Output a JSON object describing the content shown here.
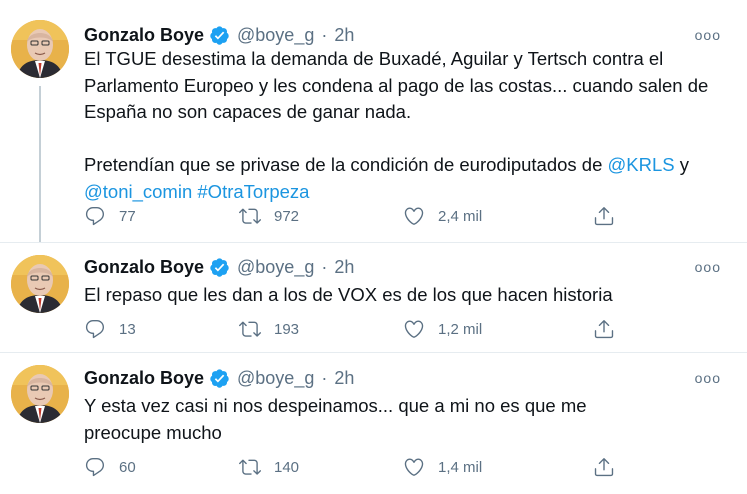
{
  "author": {
    "name": "Gonzalo Boye",
    "handle": "@boye_g",
    "separator": "·"
  },
  "more_label": "ooo",
  "tweets": [
    {
      "time": "2h",
      "text": {
        "p1": "El TGUE desestima la demanda de Buxadé, Aguilar y Tertsch contra el Parlamento Europeo y les condena al pago de las costas... cuando salen de España no son capaces de ganar nada.",
        "p2_prefix": "Pretendían que se privase de la condición de eurodiputados de ",
        "mention1": "@KRLS",
        "p2_mid": " y",
        "mention2": "@toni_comin",
        "hashtag": "#OtraTorpeza"
      },
      "replies": "77",
      "retweets": "972",
      "likes": "2,4 mil"
    },
    {
      "time": "2h",
      "text": "El repaso que les dan a los de VOX es de los que hacen historia",
      "replies": "13",
      "retweets": "193",
      "likes": "1,2 mil"
    },
    {
      "time": "2h",
      "text": "Y esta vez casi ni nos despeinamos... que a mi no es que me preocupe mucho",
      "replies": "60",
      "retweets": "140",
      "likes": "1,4 mil"
    }
  ],
  "colors": {
    "link": "#1b95e0",
    "verified": "#1da1f2",
    "muted": "#5b7083",
    "thread_line": "#c4cfd6"
  }
}
